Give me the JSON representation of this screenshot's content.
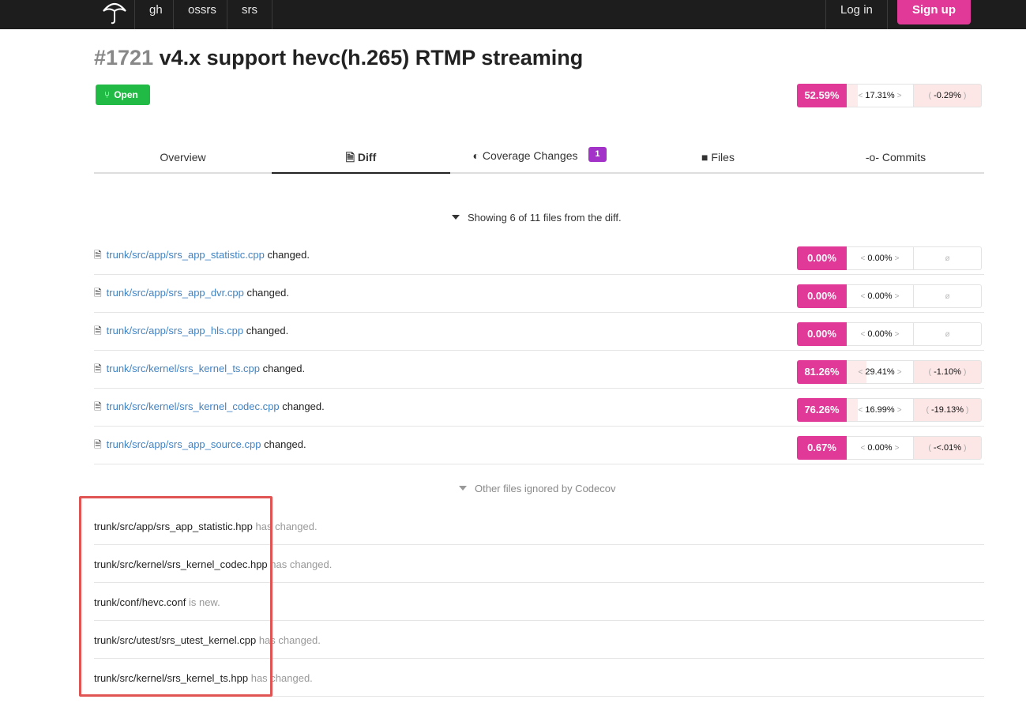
{
  "nav": {
    "logo": "codecov-umbrella-icon",
    "items": [
      "gh",
      "ossrs",
      "srs"
    ],
    "login": "Log in",
    "signup": "Sign up"
  },
  "pull": {
    "number": "#1721",
    "title": "v4.x support hevc(h.265) RTMP streaming",
    "state": "Open",
    "coverage": {
      "head": "52.59%",
      "patch": "17.31%",
      "change": "-0.29%"
    }
  },
  "tabs": [
    {
      "label": "Overview"
    },
    {
      "label": "Diff"
    },
    {
      "label": "Coverage Changes",
      "badge": "1"
    },
    {
      "label": "Files"
    },
    {
      "label": "Commits"
    }
  ],
  "showing": "Showing 6 of 11 files from the diff.",
  "files": [
    {
      "path": "trunk/src/app/srs_app_statistic.cpp",
      "suffix": "changed.",
      "head": "0.00%",
      "patch": "0.00%",
      "change": "ø"
    },
    {
      "path": "trunk/src/app/srs_app_dvr.cpp",
      "suffix": "changed.",
      "head": "0.00%",
      "patch": "0.00%",
      "change": "ø"
    },
    {
      "path": "trunk/src/app/srs_app_hls.cpp",
      "suffix": "changed.",
      "head": "0.00%",
      "patch": "0.00%",
      "change": "ø"
    },
    {
      "path": "trunk/src/kernel/srs_kernel_ts.cpp",
      "suffix": "changed.",
      "head": "81.26%",
      "patch": "29.41%",
      "change": "-1.10%"
    },
    {
      "path": "trunk/src/kernel/srs_kernel_codec.cpp",
      "suffix": "changed.",
      "head": "76.26%",
      "patch": "16.99%",
      "change": "-19.13%"
    },
    {
      "path": "trunk/src/app/srs_app_source.cpp",
      "suffix": "changed.",
      "head": "0.67%",
      "patch": "0.00%",
      "change": "-<.01%"
    }
  ],
  "ignored_header": "Other files ignored by Codecov",
  "ignored": [
    {
      "path": "trunk/src/app/srs_app_statistic.hpp",
      "status": "has changed."
    },
    {
      "path": "trunk/src/kernel/srs_kernel_codec.hpp",
      "status": "has changed."
    },
    {
      "path": "trunk/conf/hevc.conf",
      "status": "is new."
    },
    {
      "path": "trunk/src/utest/srs_utest_kernel.cpp",
      "status": "has changed."
    },
    {
      "path": "trunk/src/kernel/srs_kernel_ts.hpp",
      "status": "has changed."
    }
  ],
  "colors": {
    "brand": "#e03997",
    "open": "#21ba45",
    "badge": "#a333c8",
    "link": "#4183c4",
    "highlight": "#e05454"
  }
}
